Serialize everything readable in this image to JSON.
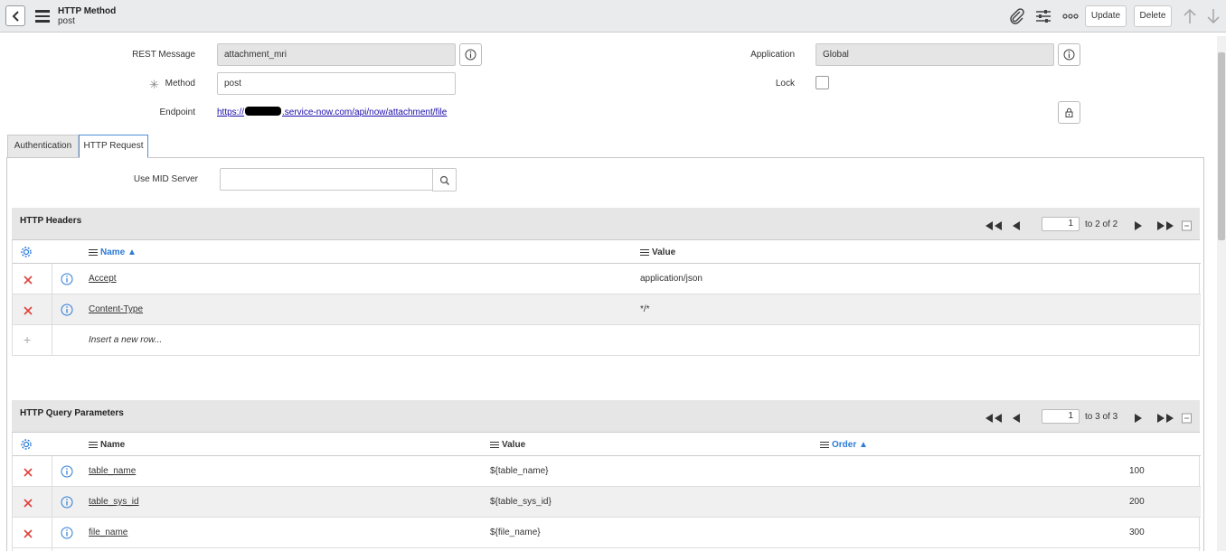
{
  "header": {
    "title": "HTTP Method",
    "subtitle": "post",
    "update_label": "Update",
    "delete_label": "Delete"
  },
  "form": {
    "rest_message_label": "REST Message",
    "rest_message_value": "attachment_mri",
    "method_label": "Method",
    "method_value": "post",
    "endpoint_label": "Endpoint",
    "endpoint_prefix": "https://",
    "endpoint_suffix": ".service-now.com/api/now/attachment/file",
    "application_label": "Application",
    "application_value": "Global",
    "lock_label": "Lock",
    "required_marker": "✳"
  },
  "tabs": [
    {
      "label": "Authentication"
    },
    {
      "label": "HTTP Request"
    }
  ],
  "request": {
    "mid_server_label": "Use MID Server",
    "mid_server_value": ""
  },
  "headers_section": {
    "title": "HTTP Headers",
    "page_value": "1",
    "page_text": "to 2 of 2",
    "col_name": "Name ▲",
    "col_value": "Value",
    "rows": [
      {
        "name": "Accept",
        "value": "application/json"
      },
      {
        "name": "Content-Type",
        "value": "*/*"
      }
    ],
    "insert_row": "Insert a new row..."
  },
  "params_section": {
    "title": "HTTP Query Parameters",
    "page_value": "1",
    "page_text": "to 3 of 3",
    "col_name": "Name",
    "col_value": "Value",
    "col_order": "Order ▲",
    "rows": [
      {
        "name": "table_name",
        "value": "${table_name}",
        "order": "100"
      },
      {
        "name": "table_sys_id",
        "value": "${table_sys_id}",
        "order": "200"
      },
      {
        "name": "file_name",
        "value": "${file_name}",
        "order": "300"
      }
    ]
  },
  "colors": {
    "accent": "#2c7bd6",
    "delete_x": "#e0403a",
    "link": "#1a0dab"
  }
}
